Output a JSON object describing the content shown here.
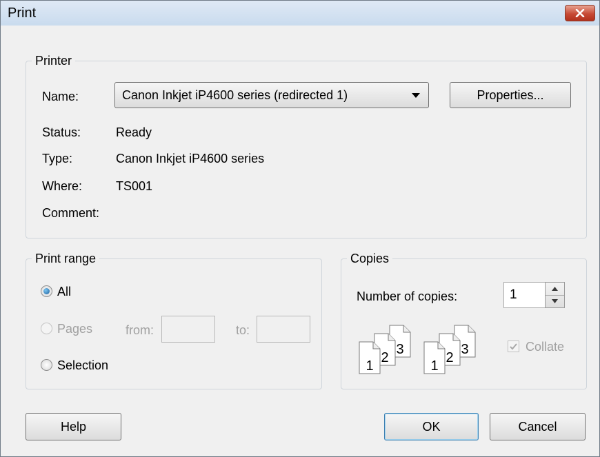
{
  "window": {
    "title": "Print"
  },
  "printer": {
    "group_label": "Printer",
    "name_label": "Name:",
    "name_value": "Canon Inkjet iP4600 series (redirected 1)",
    "properties_button": "Properties...",
    "status_label": "Status:",
    "status_value": "Ready",
    "type_label": "Type:",
    "type_value": "Canon Inkjet iP4600 series",
    "where_label": "Where:",
    "where_value": "TS001",
    "comment_label": "Comment:",
    "comment_value": ""
  },
  "print_range": {
    "group_label": "Print range",
    "options": [
      {
        "label": "All",
        "checked": true,
        "enabled": true
      },
      {
        "label": "Pages",
        "checked": false,
        "enabled": false
      },
      {
        "label": "Selection",
        "checked": false,
        "enabled": true
      }
    ],
    "from_label": "from:",
    "from_value": "",
    "to_label": "to:",
    "to_value": ""
  },
  "copies": {
    "group_label": "Copies",
    "number_label": "Number of copies:",
    "number_value": "1",
    "collate_label": "Collate",
    "collate_checked": true,
    "collate_enabled": false,
    "collate_icon_pages": [
      "1",
      "2",
      "3"
    ]
  },
  "buttons": {
    "help": "Help",
    "ok": "OK",
    "cancel": "Cancel"
  },
  "colors": {
    "titlebar": "#c9dbee",
    "close_button": "#c74a35",
    "dialog_bg": "#f0f0f0",
    "radio_selected": "#1c5f9c"
  },
  "icons": [
    "close-icon",
    "dropdown-arrow-icon",
    "spin-up-icon",
    "spin-down-icon",
    "checkmark-icon",
    "collate-pages-icon"
  ]
}
